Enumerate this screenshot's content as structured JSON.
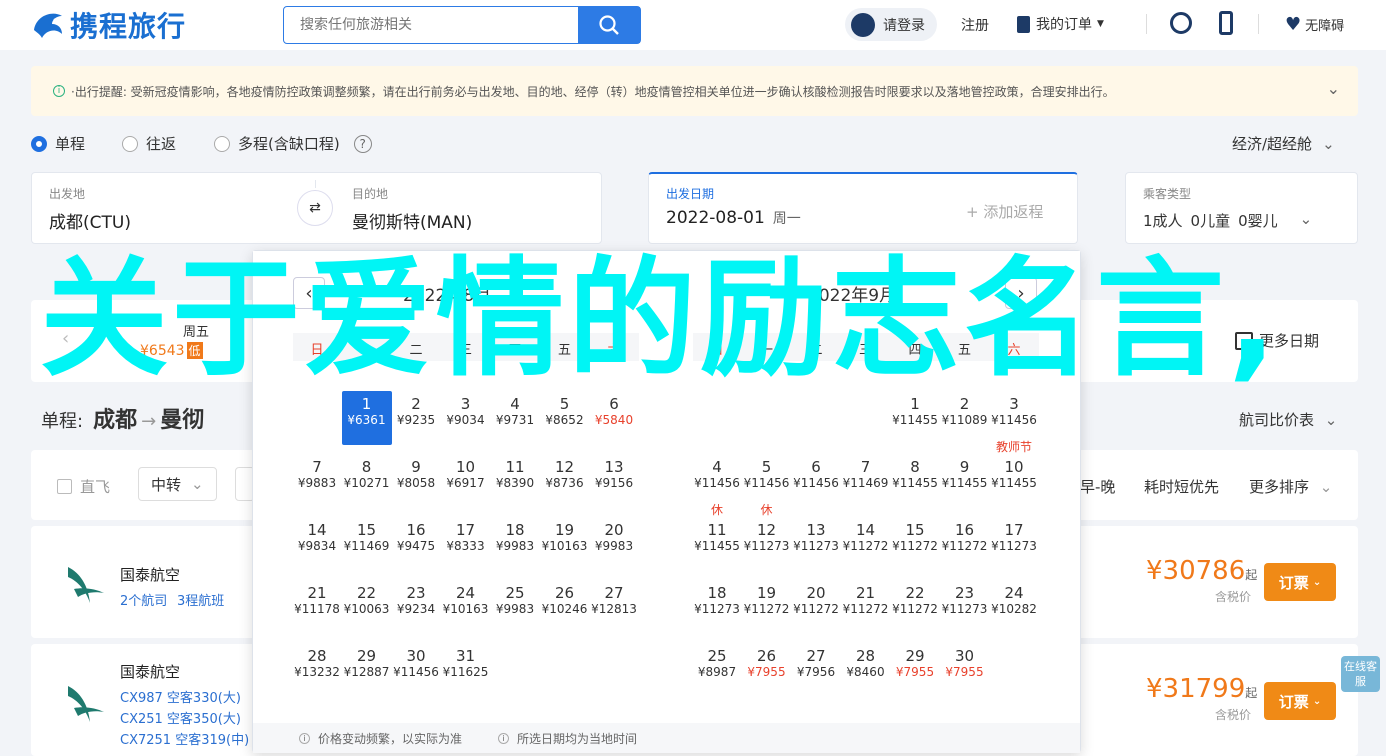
{
  "header": {
    "logo_text": "携程旅行",
    "search_placeholder": "搜索任何旅游相关",
    "login": "请登录",
    "register": "注册",
    "orders": "我的订单",
    "accessibility": "无障碍"
  },
  "notice": {
    "text": "·出行提醒: 受新冠疫情影响，各地疫情防控政策调整频繁，请在出行前务必与出发地、目的地、经停（转）地疫情管控相关单位进一步确认核酸检测报告时限要求以及落地管控政策，合理安排出行。"
  },
  "trip_types": [
    "单程",
    "往返",
    "多程(含缺口程)"
  ],
  "cabin": "经济/超经舱",
  "search_form": {
    "from_label": "出发地",
    "from_value": "成都(CTU)",
    "to_label": "目的地",
    "to_value": "曼彻斯特(MAN)",
    "date_label": "出发日期",
    "date_value": "2022-08-01",
    "weekday": "周一",
    "return_placeholder": "+ 添加返程",
    "pax_label": "乘客类型",
    "adult": "1成人",
    "child": "0儿童",
    "infant": "0婴儿"
  },
  "calendar": {
    "weekdays": [
      "日",
      "一",
      "二",
      "三",
      "四",
      "五",
      "六"
    ],
    "left_title": "2022年8月",
    "right_title": "2022年9月",
    "august": [
      {
        "d": "1",
        "p": "¥6361",
        "sel": true
      },
      {
        "d": "2",
        "p": "¥9235"
      },
      {
        "d": "3",
        "p": "¥9034"
      },
      {
        "d": "4",
        "p": "¥9731"
      },
      {
        "d": "5",
        "p": "¥8652"
      },
      {
        "d": "6",
        "p": "¥5840",
        "red": true
      },
      {
        "d": "7",
        "p": "¥9883"
      },
      {
        "d": "8",
        "p": "¥10271"
      },
      {
        "d": "9",
        "p": "¥8058"
      },
      {
        "d": "10",
        "p": "¥6917"
      },
      {
        "d": "11",
        "p": "¥8390"
      },
      {
        "d": "12",
        "p": "¥8736"
      },
      {
        "d": "13",
        "p": "¥9156"
      },
      {
        "d": "14",
        "p": "¥9834"
      },
      {
        "d": "15",
        "p": "¥11469"
      },
      {
        "d": "16",
        "p": "¥9475"
      },
      {
        "d": "17",
        "p": "¥8333"
      },
      {
        "d": "18",
        "p": "¥9983"
      },
      {
        "d": "19",
        "p": "¥10163"
      },
      {
        "d": "20",
        "p": "¥9983"
      },
      {
        "d": "21",
        "p": "¥11178"
      },
      {
        "d": "22",
        "p": "¥10063"
      },
      {
        "d": "23",
        "p": "¥9234"
      },
      {
        "d": "24",
        "p": "¥10163"
      },
      {
        "d": "25",
        "p": "¥9983"
      },
      {
        "d": "26",
        "p": "¥10246"
      },
      {
        "d": "27",
        "p": "¥12813"
      },
      {
        "d": "28",
        "p": "¥13232"
      },
      {
        "d": "29",
        "p": "¥12887"
      },
      {
        "d": "30",
        "p": "¥11456"
      },
      {
        "d": "31",
        "p": "¥11625"
      }
    ],
    "september": [
      {
        "d": "1",
        "p": "¥11455"
      },
      {
        "d": "2",
        "p": "¥11089"
      },
      {
        "d": "3",
        "p": "¥11456"
      },
      {
        "d": "4",
        "p": "¥11456"
      },
      {
        "d": "5",
        "p": "¥11456"
      },
      {
        "d": "6",
        "p": "¥11456"
      },
      {
        "d": "7",
        "p": "¥11469"
      },
      {
        "d": "8",
        "p": "¥11455"
      },
      {
        "d": "9",
        "p": "¥11455"
      },
      {
        "d": "10",
        "p": "¥11455",
        "tag": "教师节"
      },
      {
        "d": "11",
        "p": "¥11455",
        "tag": "休"
      },
      {
        "d": "12",
        "p": "¥11273",
        "tag": "休"
      },
      {
        "d": "13",
        "p": "¥11273"
      },
      {
        "d": "14",
        "p": "¥11272"
      },
      {
        "d": "15",
        "p": "¥11272"
      },
      {
        "d": "16",
        "p": "¥11272"
      },
      {
        "d": "17",
        "p": "¥11273"
      },
      {
        "d": "18",
        "p": "¥11273"
      },
      {
        "d": "19",
        "p": "¥11272"
      },
      {
        "d": "20",
        "p": "¥11272"
      },
      {
        "d": "21",
        "p": "¥11272"
      },
      {
        "d": "22",
        "p": "¥11272"
      },
      {
        "d": "23",
        "p": "¥11273"
      },
      {
        "d": "24",
        "p": "¥10282"
      },
      {
        "d": "25",
        "p": "¥8987"
      },
      {
        "d": "26",
        "p": "¥7955",
        "red": true
      },
      {
        "d": "27",
        "p": "¥7956"
      },
      {
        "d": "28",
        "p": "¥8460"
      },
      {
        "d": "29",
        "p": "¥7955",
        "red": true
      },
      {
        "d": "30",
        "p": "¥7955",
        "red": true
      }
    ],
    "footer_note1": "价格变动频繁，以实际为准",
    "footer_note2": "所选日期均为当地时间"
  },
  "date_strip": {
    "weekday": "周五",
    "price": "¥6543",
    "low_badge": "低",
    "more_dates": "更多日期"
  },
  "route": {
    "type": "单程:",
    "from": "成都",
    "to": "曼彻"
  },
  "airline_compare": "航司比价表",
  "filters": {
    "direct": "直飞",
    "transfer": "中转",
    "early_late": "早-晚",
    "shortest": "耗时短优先",
    "more_sort": "更多排序"
  },
  "flights": [
    {
      "airline": "国泰航空",
      "sub1": "2个航司",
      "sub2": "3程航班",
      "price": "¥30786",
      "unit": "起",
      "tax": "含税价",
      "book": "订票"
    },
    {
      "airline": "国泰航空",
      "legs": [
        "CX987 空客330(大)",
        "CX251 空客350(大)",
        "CX7251 空客319(中)"
      ],
      "price": "¥31799",
      "unit": "起",
      "tax": "含税价",
      "book": "订票"
    }
  ],
  "online_service": "在线客服",
  "overlay_text": "关于爱情的励志名言,"
}
